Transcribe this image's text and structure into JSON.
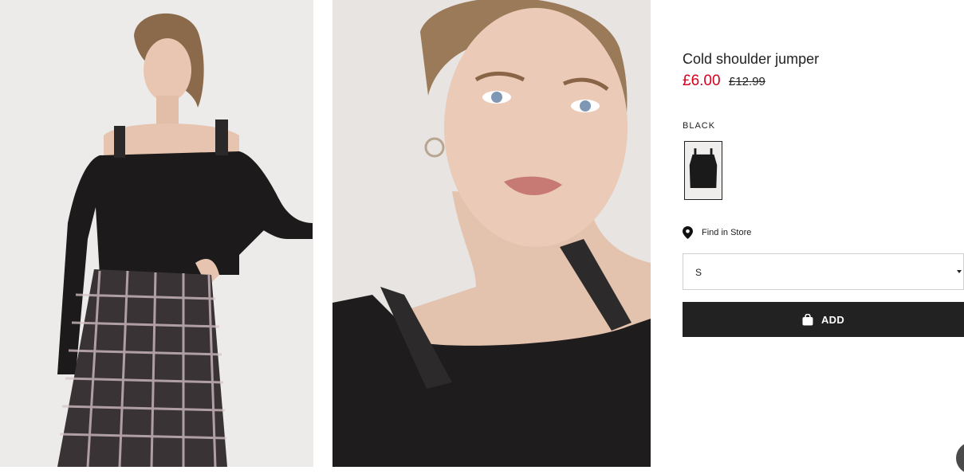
{
  "product": {
    "title": "Cold shoulder jumper",
    "price_sale": "£6.00",
    "price_original": "£12.99",
    "color_label": "BLACK",
    "find_in_store": "Find in Store",
    "size_selected": "S",
    "add_button_label": "ADD"
  },
  "colors": {
    "sale_price": "#d6001c",
    "button_bg": "#222222",
    "text": "#222222"
  },
  "icons": {
    "location": "location-pin-icon",
    "bag": "shopping-bag-icon",
    "dropdown": "chevron-down-icon",
    "chat": "chat-icon"
  }
}
